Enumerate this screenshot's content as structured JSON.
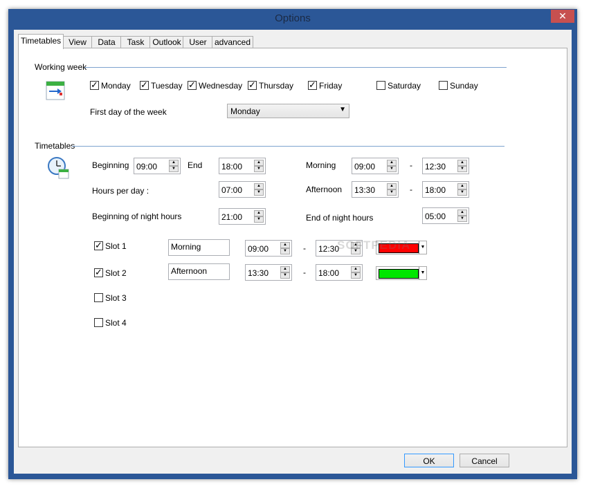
{
  "window": {
    "title": "Options",
    "close_glyph": "✕"
  },
  "tabs": [
    "Timetables",
    "View",
    "Data",
    "Task",
    "Outlook",
    "User",
    "advanced"
  ],
  "working_week": {
    "section_label": "Working week",
    "days": [
      {
        "label": "Monday",
        "checked": true
      },
      {
        "label": "Tuesday",
        "checked": true
      },
      {
        "label": "Wednesday",
        "checked": true
      },
      {
        "label": "Thursday",
        "checked": true
      },
      {
        "label": "Friday",
        "checked": true
      },
      {
        "label": "Saturday",
        "checked": false
      },
      {
        "label": "Sunday",
        "checked": false
      }
    ],
    "first_day_label": "First day of the week",
    "first_day_value": "Monday"
  },
  "timetables": {
    "section_label": "Timetables",
    "beginning_label": "Beginning",
    "beginning_value": "09:00",
    "end_label": "End",
    "end_value": "18:00",
    "morning_label": "Morning",
    "morning_start": "09:00",
    "morning_end": "12:30",
    "hours_per_day_label": "Hours per day :",
    "hours_per_day_value": "07:00",
    "afternoon_label": "Afternoon",
    "afternoon_start": "13:30",
    "afternoon_end": "18:00",
    "night_begin_label": "Beginning of night hours",
    "night_begin_value": "21:00",
    "night_end_label": "End of night hours",
    "night_end_value": "05:00",
    "dash": "-"
  },
  "slots": [
    {
      "label": "Slot 1",
      "checked": true,
      "name": "Morning",
      "start": "09:00",
      "end": "12:30",
      "color": "#ff0000"
    },
    {
      "label": "Slot 2",
      "checked": true,
      "name": "Afternoon",
      "start": "13:30",
      "end": "18:00",
      "color": "#00e600"
    },
    {
      "label": "Slot 3",
      "checked": false
    },
    {
      "label": "Slot 4",
      "checked": false
    }
  ],
  "buttons": {
    "ok": "OK",
    "cancel": "Cancel"
  },
  "watermark": "SOFTPEDIA"
}
